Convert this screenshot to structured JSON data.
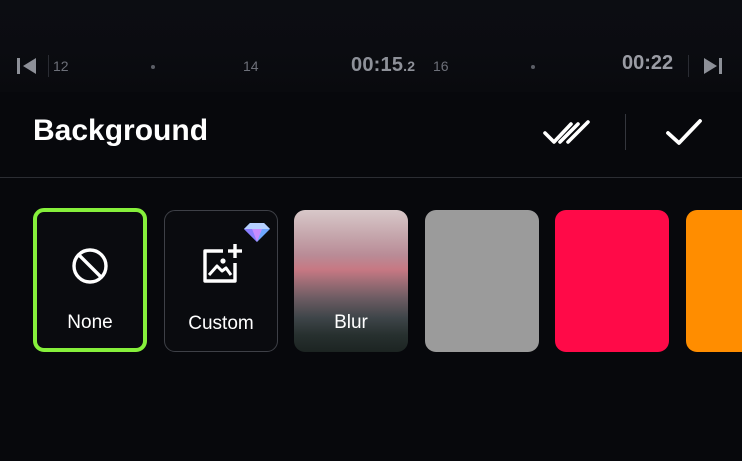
{
  "timeline": {
    "ticks": [
      "12",
      "14",
      "16"
    ],
    "current_time_main": "00:15",
    "current_time_frac": ".2",
    "total_time": "00:22",
    "icons": {
      "skip_start": "skip-to-start-icon",
      "skip_end": "skip-to-end-icon"
    }
  },
  "header": {
    "title": "Background",
    "icons": {
      "apply_all": "double-check-icon",
      "confirm": "check-icon"
    }
  },
  "options": [
    {
      "label": "None",
      "icon": "prohibit-icon",
      "selected": true
    },
    {
      "label": "Custom",
      "icon": "add-image-icon",
      "badge": "diamond-icon"
    },
    {
      "label": "Blur"
    },
    {
      "label": "",
      "color": "#9b9b9b"
    },
    {
      "label": "",
      "color": "#ff0a48"
    },
    {
      "label": "",
      "color": "#ff8d00"
    }
  ],
  "colors": {
    "selection_border": "#86f03b",
    "background": "#07080c"
  }
}
